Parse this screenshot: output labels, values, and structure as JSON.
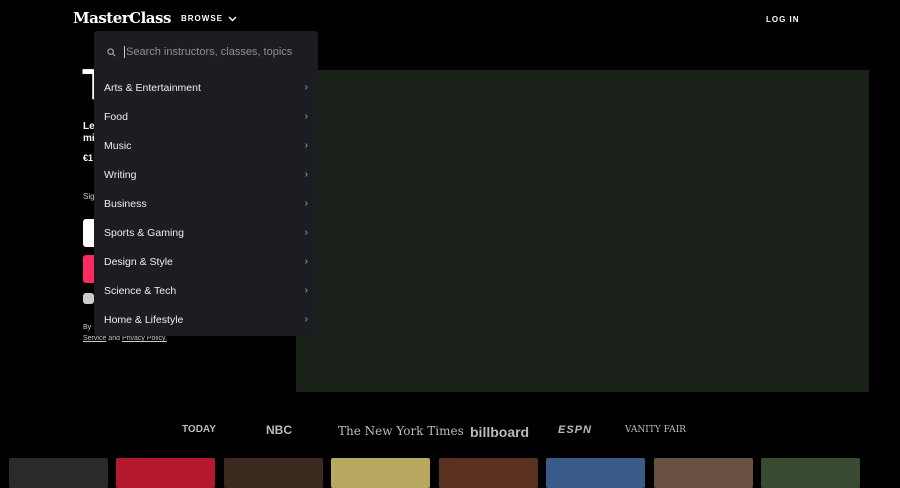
{
  "header": {
    "logo": "MasterClass",
    "browse": "BROWSE",
    "login": "LOG IN"
  },
  "hero": {
    "title_partial": "T",
    "line1_partial": "Le",
    "line2_partial": "mi",
    "price_partial": "€1",
    "signup_partial": "Sig",
    "terms_partial": "By",
    "terms_links": {
      "service": "Service",
      "and": "and",
      "privacy": "Privacy Policy."
    }
  },
  "dropdown": {
    "search_placeholder": "Search instructors, classes, topics",
    "items": [
      {
        "label": "Arts & Entertainment"
      },
      {
        "label": "Food"
      },
      {
        "label": "Music"
      },
      {
        "label": "Writing"
      },
      {
        "label": "Business"
      },
      {
        "label": "Sports & Gaming"
      },
      {
        "label": "Design & Style"
      },
      {
        "label": "Science & Tech"
      },
      {
        "label": "Home & Lifestyle"
      }
    ]
  },
  "press": [
    "TODAY",
    "NBC",
    "The New York Times",
    "billboard",
    "ESPN",
    "VANITY FAIR"
  ],
  "colors": {
    "accent": "#ff2a5f",
    "dropdown_bg": "#1c1d22",
    "video_bg": "#1a2119"
  }
}
